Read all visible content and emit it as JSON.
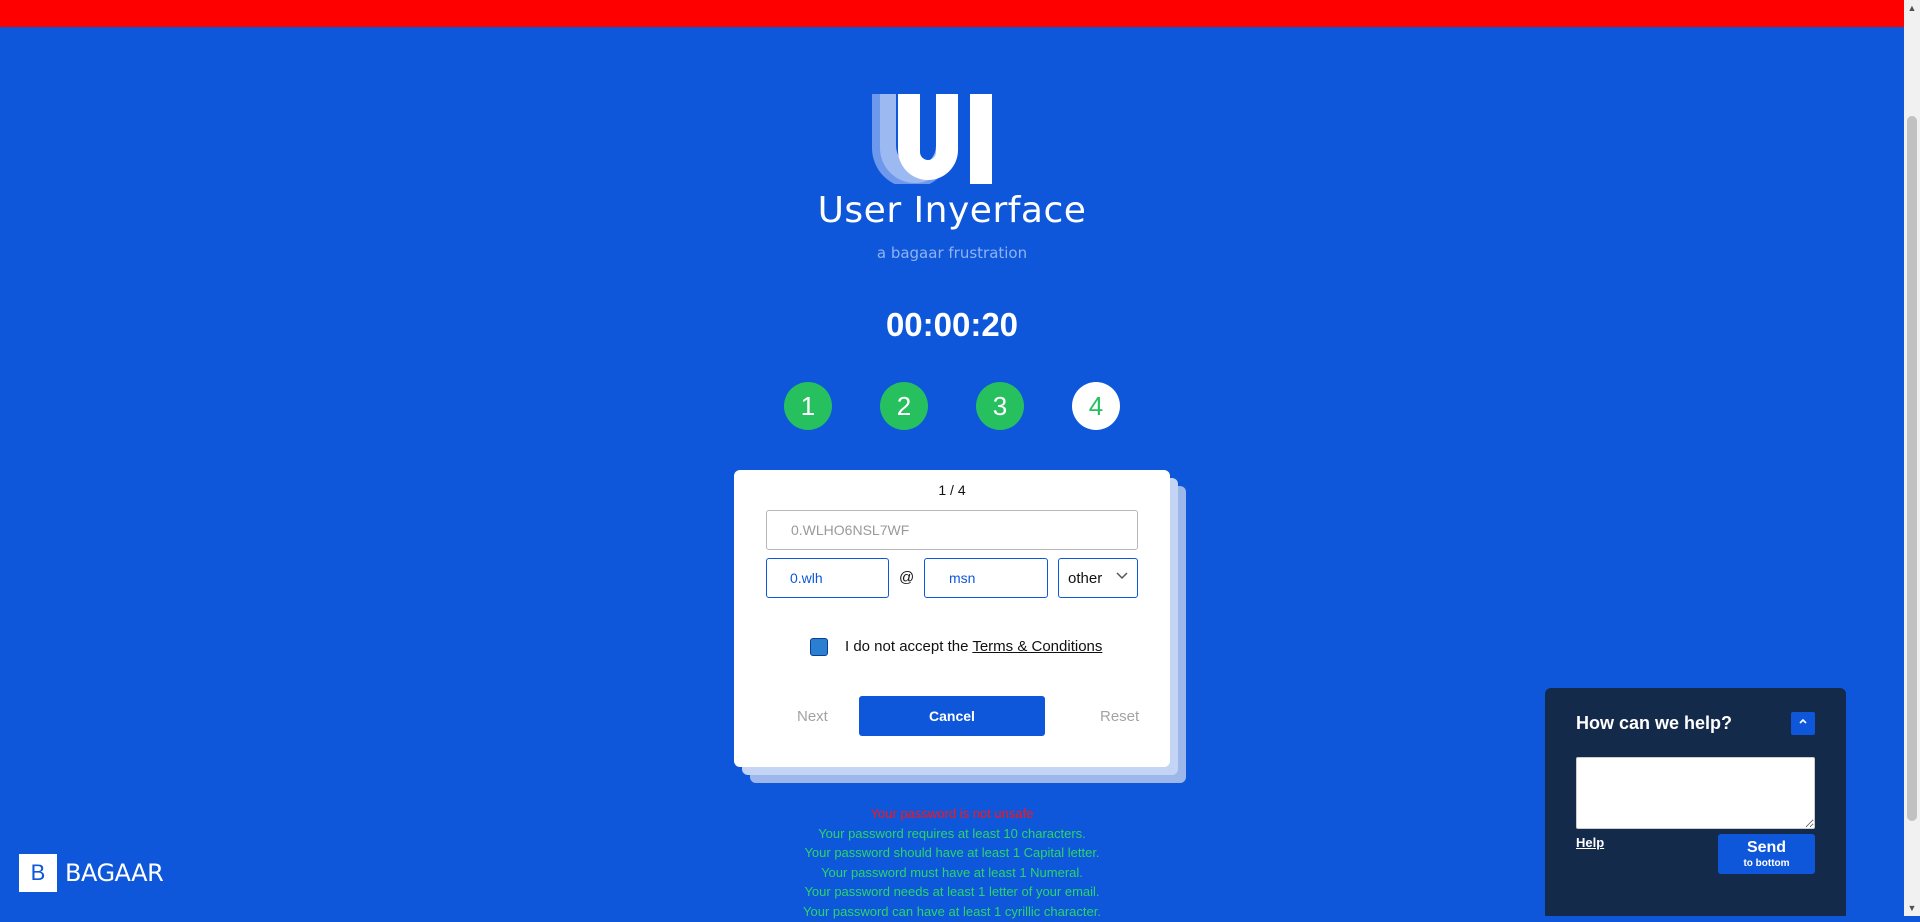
{
  "app": {
    "logo_text": "UI",
    "title": "User Inyerface",
    "subtitle": "a bagaar frustration"
  },
  "timer": "00:00:20",
  "steps": [
    {
      "label": "1",
      "state": "done"
    },
    {
      "label": "2",
      "state": "done"
    },
    {
      "label": "3",
      "state": "done"
    },
    {
      "label": "4",
      "state": "active"
    }
  ],
  "form": {
    "page_indicator": "1 / 4",
    "password_value": "0.WLHO6NSL7WF",
    "email_user_value": "0.wlh",
    "at_sign": "@",
    "email_domain_value": "msn",
    "tld_selected": "other",
    "checkbox_label": "I do not accept the",
    "terms_link": "Terms & Conditions",
    "next_label": "Next",
    "cancel_label": "Cancel",
    "reset_label": "Reset"
  },
  "validation": {
    "error": "Your password is not unsafe",
    "hints": [
      "Your password requires at least 10 characters.",
      "Your password should have at least 1 Capital letter.",
      "Your password must have at least 1 Numeral.",
      "Your password needs at least 1 letter of your email.",
      "Your password can have at least 1 cyrillic character."
    ]
  },
  "footer": {
    "brand_mark": "B",
    "brand_name": "BAGAAR"
  },
  "help_widget": {
    "title": "How can we help?",
    "toggle_icon": "chevron-up-icon",
    "help_link": "Help",
    "send_label": "Send",
    "send_sublabel": "to bottom"
  },
  "colors": {
    "background": "#0f57da",
    "top_bar": "#fe0000",
    "step_done": "#27c05f",
    "error_text": "#ff1414",
    "hint_text": "#2bd568",
    "help_bg": "#132a4a"
  }
}
